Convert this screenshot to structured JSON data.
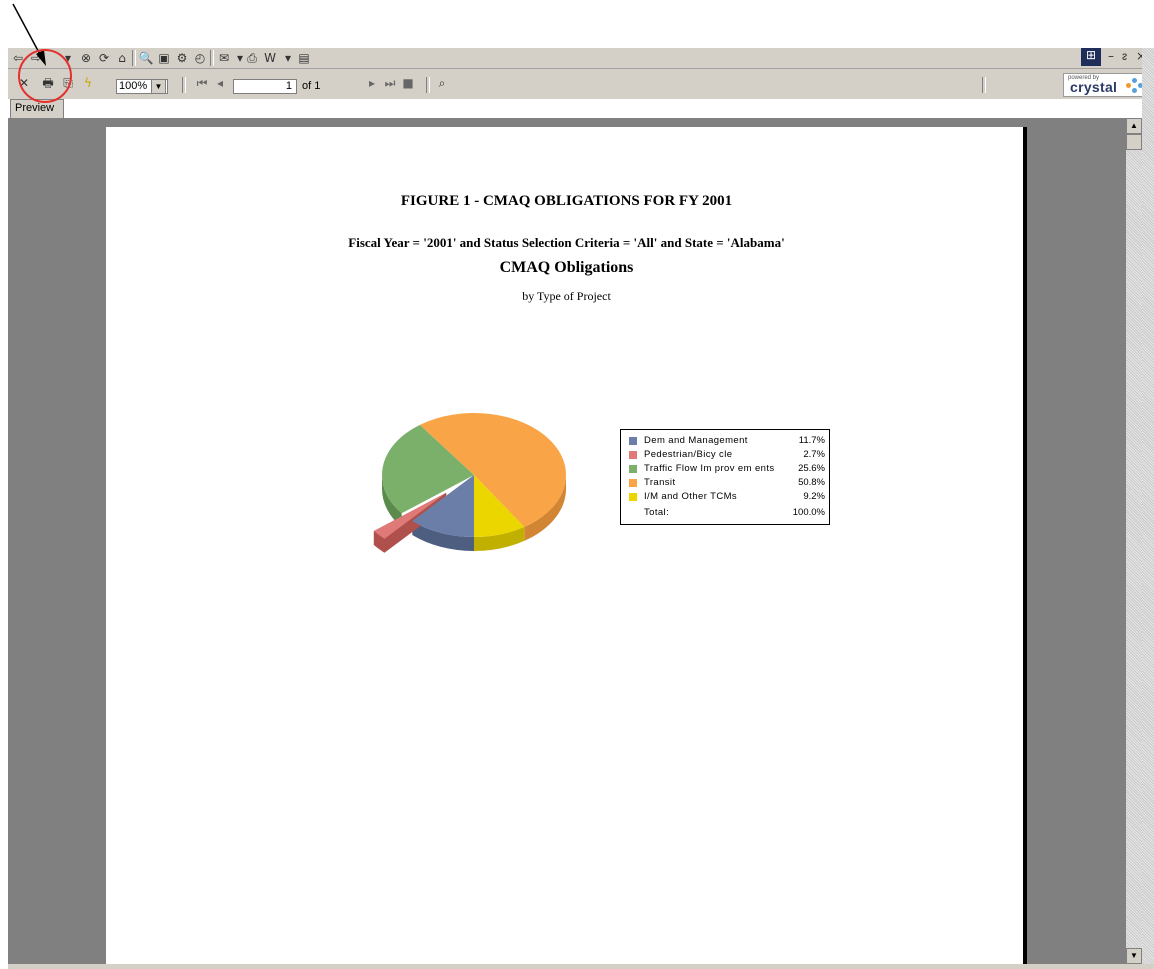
{
  "viewer": {
    "zoom": "100%",
    "page_current": "1",
    "page_of": "of 1",
    "tab_label": "Preview",
    "brand_small": "powered by",
    "brand_name": "crystal",
    "window_controls": [
      "–",
      "ᴤ",
      "×"
    ]
  },
  "report": {
    "figure_title": "FIGURE 1 - CMAQ OBLIGATIONS FOR FY 2001",
    "criteria": "Fiscal Year = '2001' and Status Selection Criteria = 'All' and State = 'Alabama'",
    "chart_title": "CMAQ Obligations",
    "chart_subtitle": "by Type of Project"
  },
  "chart_data": {
    "type": "pie",
    "title": "CMAQ Obligations",
    "subtitle": "by Type of Project",
    "categories": [
      "Demand Management",
      "Pedestrian/Bicycle",
      "Traffic Flow Improvements",
      "Transit",
      "I/M and Other TCMs"
    ],
    "labels": [
      "Dem and Management",
      "Pedestrian/Bicy cle",
      "Traffic Flow Im prov em ents",
      "Transit",
      "I/M and Other TCMs"
    ],
    "values": [
      11.7,
      2.7,
      25.6,
      50.8,
      9.2
    ],
    "value_labels": [
      "11.7%",
      "2.7%",
      "25.6%",
      "50.8%",
      "9.2%"
    ],
    "colors": [
      "#6b7ea8",
      "#e07a78",
      "#7bb06a",
      "#f9a547",
      "#ecd600"
    ],
    "side_colors": [
      "#4e5e80",
      "#b0504c",
      "#5a8a4c",
      "#d28532",
      "#c2b000"
    ],
    "total_label": "Total:",
    "total_value": "100.0%",
    "legend_position": "right",
    "exploded": "Pedestrian/Bicycle",
    "style": "3d"
  }
}
